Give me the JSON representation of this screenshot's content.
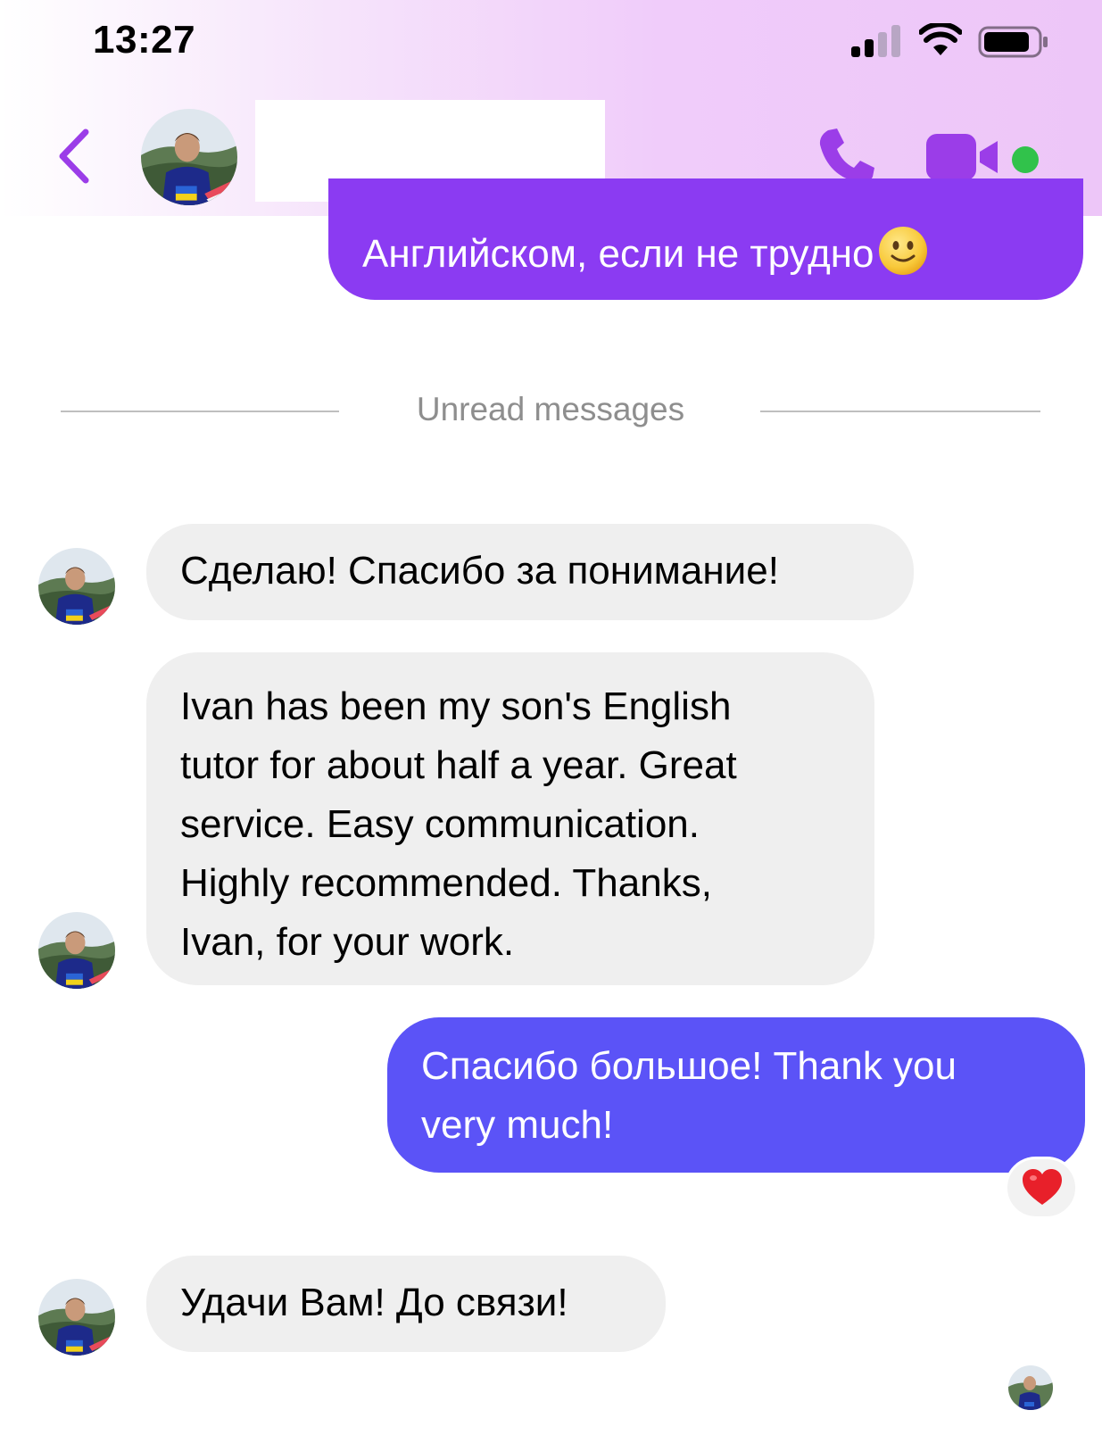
{
  "status_bar": {
    "time": "13:27",
    "icons": [
      "cellular-signal-icon",
      "wifi-icon",
      "battery-icon"
    ]
  },
  "header": {
    "icons": {
      "back": "chevron-left-icon",
      "call": "phone-icon",
      "video": "video-camera-icon",
      "presence": "online-dot"
    },
    "accent_color": "#9b3de8",
    "online_color": "#31c24b"
  },
  "divider": {
    "label": "Unread messages"
  },
  "messages": [
    {
      "direction": "out",
      "text": "Английском, если не трудно",
      "emoji": "slightly-smiling-face",
      "color": "#8b3bf2"
    },
    {
      "direction": "in",
      "text": "Сделаю! Спасибо за понимание!"
    },
    {
      "direction": "in",
      "lines": [
        "Ivan has been my son's  English",
        "tutor for about half a year. Great",
        "service. Easy communication.",
        "Highly recommended. Thanks,",
        "Ivan, for your work."
      ]
    },
    {
      "direction": "out",
      "lines": [
        "Спасибо большое! Thank you",
        "very much!"
      ],
      "color": "#5b53f7",
      "reaction": "red-heart"
    },
    {
      "direction": "in",
      "text": "Удачи Вам! До связи!"
    }
  ]
}
